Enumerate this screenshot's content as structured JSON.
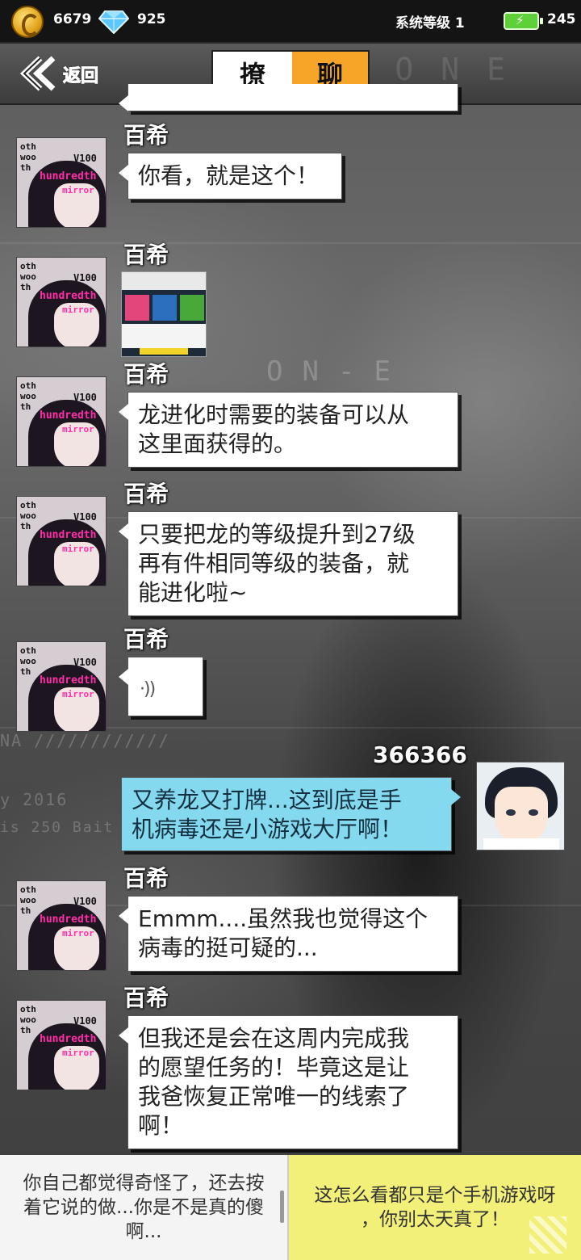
{
  "status_bar": {
    "coins": "6679",
    "diamonds": "925",
    "system_level": "系统等级 1",
    "energy": "245",
    "coin_icon": "coin-icon",
    "diamond_icon": "diamond-icon",
    "energy_icon": "battery-icon"
  },
  "header": {
    "back_label": "返回",
    "title_left": "撩",
    "title_right": "聊",
    "accent": "#f7a528"
  },
  "messages": [
    {
      "sender": "百希",
      "type": "text",
      "text": "你看，就是这个！"
    },
    {
      "sender": "百希",
      "type": "image",
      "image": "game-screenshot-thumbnail"
    },
    {
      "sender": "百希",
      "type": "text",
      "lines": [
        "龙进化时需要的装备可以从",
        "这里面获得的。"
      ]
    },
    {
      "sender": "百希",
      "type": "text",
      "lines": [
        "只要把龙的等级提升到27级",
        "再有件相同等级的装备，就",
        "能进化啦~"
      ]
    },
    {
      "sender": "百希",
      "type": "voice",
      "icon": "voice-icon"
    },
    {
      "sender": "366366",
      "type": "text",
      "mine": true,
      "lines": [
        "又养龙又打牌...这到底是手",
        "机病毒还是小游戏大厅啊！"
      ]
    },
    {
      "sender": "百希",
      "type": "text",
      "lines": [
        "Emmm....虽然我也觉得这个",
        "病毒的挺可疑的..."
      ]
    },
    {
      "sender": "百希",
      "type": "text",
      "lines": [
        "但我还是会在这周内完成我",
        "的愿望任务的！毕竟这是让",
        "我爸恢复正常唯一的线索了",
        "啊！"
      ]
    }
  ],
  "avatar_text": {
    "t1": "oth\nwoo\nth",
    "t2": "hundredth",
    "t3": "mirror\nmp",
    "t4": "V100"
  },
  "choices": [
    {
      "lines": [
        "你自己都觉得奇怪了，还去按",
        "着它说的做...你是不是真的傻",
        "啊..."
      ],
      "bg": "#f4f4f4"
    },
    {
      "lines": [
        "这怎么看都只是个手机游戏呀",
        "，你别太天真了！"
      ],
      "bg": "#f3f07a"
    }
  ],
  "colors": {
    "my_bubble": "#84d9ee",
    "other_bubble": "#ffffff"
  }
}
